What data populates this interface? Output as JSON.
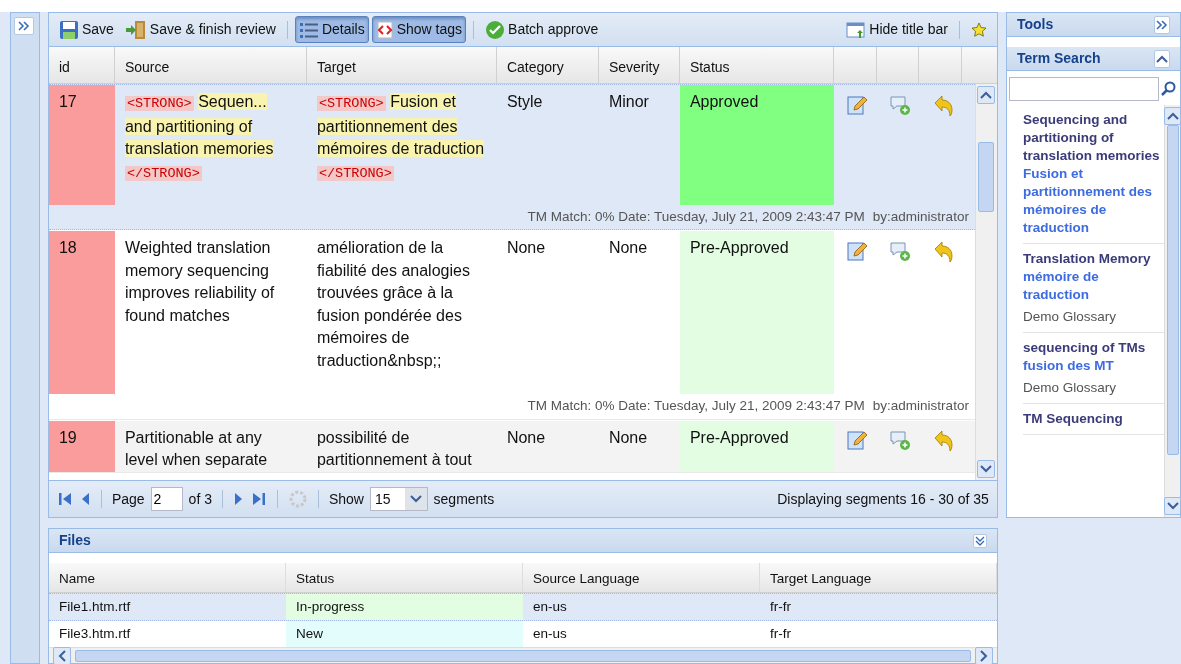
{
  "toolbar": [
    {
      "kind": "button",
      "label": "Save"
    },
    {
      "kind": "button",
      "label": "Save & finish review"
    },
    {
      "kind": "toggle",
      "label": "Details",
      "selected": true
    },
    {
      "kind": "toggle",
      "label": "Show tags",
      "selected": true
    },
    {
      "kind": "button",
      "label": "Batch approve"
    }
  ],
  "toolbar_right": [
    {
      "kind": "button",
      "label": "Hide title bar"
    }
  ],
  "grid": {
    "columns": [
      "id",
      "Source",
      "Target",
      "Category",
      "Severity",
      "Status"
    ],
    "rows": [
      {
        "id": "17",
        "selected": true,
        "source": [
          {
            "kind": "tag",
            "text": "<STRONG>"
          },
          {
            "kind": "marked",
            "text": "Sequen..."
          },
          {
            "kind": "marked",
            "text": "and partitioning of translation memories"
          },
          {
            "kind": "tag",
            "text": "</STRONG>"
          }
        ],
        "target": [
          {
            "kind": "tag",
            "text": "<STRONG>"
          },
          {
            "kind": "marked",
            "text": "Fusion et partitionnement des mémoires de traduction"
          },
          {
            "kind": "tag",
            "text": "</STRONG>"
          }
        ],
        "category": "Style",
        "severity": "Minor",
        "status": "Approved",
        "color": "#80ff80",
        "info": "TM Match: 0% Date: Tuesday, July 21, 2009 2:43:47 PM",
        "author": "by:administrator"
      },
      {
        "id": "18",
        "selected": false,
        "source": [
          {
            "kind": "plain",
            "text": "Weighted translation memory sequencing improves reliability of found matches"
          }
        ],
        "target": [
          {
            "kind": "plain",
            "text": "amélioration de la fiabilité des analogies trouvées grâce à la fusion pondérée des mémoires de traduction&nbsp;;"
          }
        ],
        "category": "None",
        "severity": "None",
        "status": "Pre-Approved",
        "color": "#e3fde3",
        "info": "TM Match: 0% Date: Tuesday, July 21, 2009 2:43:47 PM",
        "author": "by:administrator"
      },
      {
        "id": "19",
        "selected": false,
        "source": [
          {
            "kind": "plain",
            "text": "Partitionable at any level when separate"
          }
        ],
        "target": [
          {
            "kind": "plain",
            "text": "possibilité de partitionnement à tout"
          }
        ],
        "category": "None",
        "severity": "None",
        "status": "Pre-Approved",
        "color": "#e3fde3"
      }
    ]
  },
  "pager": {
    "page_label": "Page",
    "page": "2",
    "of": "of 3",
    "show_label": "Show",
    "page_size": "15",
    "unit": "segments",
    "display": "Displaying segments 16 - 30 of 35"
  },
  "tools": {
    "title": "Tools",
    "term_search": {
      "title": "Term Search",
      "results": [
        {
          "term": "Sequencing and partitioning of translation memories",
          "translation": "Fusion et partitionnement des mémoires de traduction"
        },
        {
          "term": "Translation Memory",
          "translation": "mémoire de traduction",
          "glossary": "Demo Glossary"
        },
        {
          "term": "sequencing of TMs",
          "translation": "fusion des MT",
          "glossary": "Demo Glossary"
        },
        {
          "term": "TM Sequencing"
        }
      ]
    }
  },
  "files": {
    "title": "Files",
    "columns": [
      "Name",
      "Status",
      "Source Language",
      "Target Language"
    ],
    "rows": [
      {
        "name": "File1.htm.rtf",
        "status": "In-progress",
        "color": "#e3fde3",
        "source": "en-us",
        "target": "fr-fr",
        "selected": true
      },
      {
        "name": "File3.htm.rtf",
        "status": "New",
        "color": "#e3fdfd",
        "source": "en-us",
        "target": "fr-fr",
        "selected": false
      }
    ]
  }
}
